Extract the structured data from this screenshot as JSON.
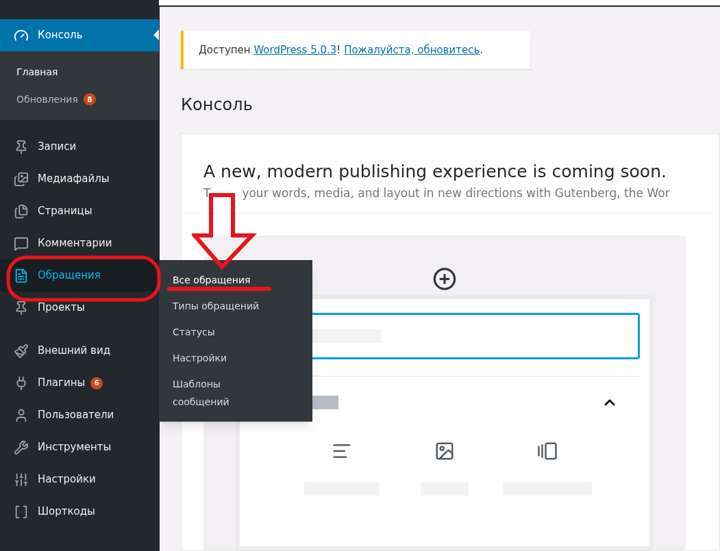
{
  "sidebar": {
    "groups": [
      {
        "items": [
          {
            "label": "Консоль",
            "current": true,
            "hovered": false,
            "children": [
              {
                "label": "Главная",
                "selected": true
              },
              {
                "label": "Обновления",
                "selected": false,
                "badge": "8"
              }
            ]
          }
        ]
      },
      {
        "items": [
          {
            "label": "Записи",
            "current": false,
            "hovered": false
          },
          {
            "label": "Медиафайлы",
            "current": false,
            "hovered": false
          },
          {
            "label": "Страницы",
            "current": false,
            "hovered": false
          },
          {
            "label": "Комментарии",
            "current": false,
            "hovered": false
          },
          {
            "label": "Обращения",
            "current": false,
            "hovered": true
          },
          {
            "label": "Проекты",
            "current": false,
            "hovered": false
          }
        ]
      },
      {
        "items": [
          {
            "label": "Внешний вид",
            "current": false,
            "hovered": false
          },
          {
            "label": "Плагины",
            "current": false,
            "hovered": false,
            "badge": "6"
          },
          {
            "label": "Пользователи",
            "current": false,
            "hovered": false
          },
          {
            "label": "Инструменты",
            "current": false,
            "hovered": false
          },
          {
            "label": "Настройки",
            "current": false,
            "hovered": false
          },
          {
            "label": "Шорткоды",
            "current": false,
            "hovered": false
          }
        ]
      }
    ]
  },
  "flyout": {
    "items": [
      {
        "label": "Все обращения",
        "selected": true
      },
      {
        "label": "Типы обращений",
        "selected": false
      },
      {
        "label": "Статусы",
        "selected": false
      },
      {
        "label": "Настройки",
        "selected": false
      },
      {
        "label": "Шаблоны сообщений",
        "selected": false
      }
    ]
  },
  "notice": {
    "text": "Доступен ",
    "link1": "WordPress 5.0.3",
    "sep": "! ",
    "link2": "Пожалуйста, обновитесь",
    "end": "."
  },
  "page_title": "Консоль",
  "promo": {
    "heading": "A new, modern publishing experience is coming soon.",
    "text_start": "T",
    "text": "your words, media, and layout in new directions with Gutenberg, the Wor"
  },
  "annotations": [
    {
      "kind": "ellipse"
    },
    {
      "kind": "arrow"
    },
    {
      "kind": "underline"
    }
  ]
}
